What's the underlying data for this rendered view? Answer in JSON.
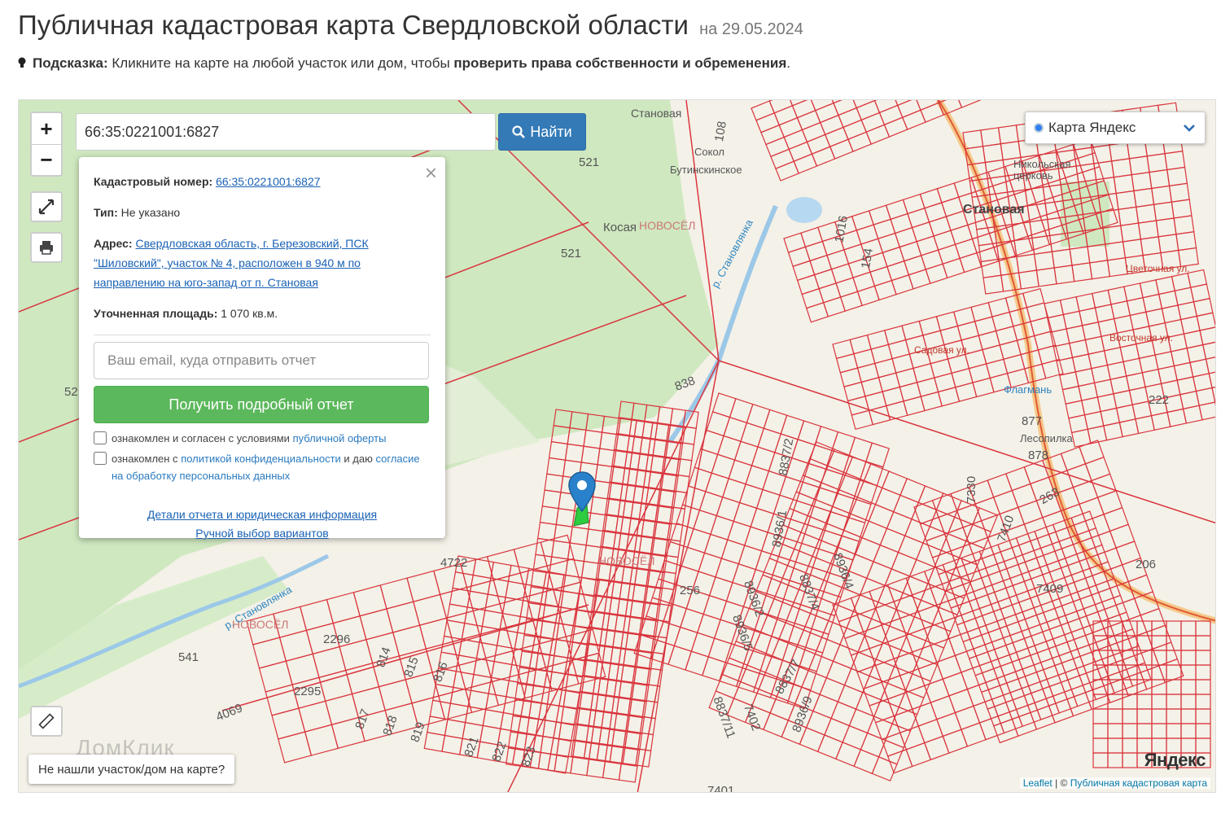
{
  "header": {
    "title": "Публичная кадастровая карта Свердловской области",
    "date": "на 29.05.2024"
  },
  "hint": {
    "label": "Подсказка:",
    "text": "Кликните на карте на любой участок или дом, чтобы",
    "bold_text": "проверить права собственности и обременения",
    "end": "."
  },
  "search": {
    "value": "66:35:0221001:6827",
    "button_label": "Найти"
  },
  "zoom": {
    "in": "+",
    "out": "−"
  },
  "layer": {
    "selected": "Карта Яндекс"
  },
  "popup": {
    "cadastral_label": "Кадастровый номер:",
    "cadastral_value": "66:35:0221001:6827",
    "type_label": "Тип:",
    "type_value": "Не указано",
    "address_label": "Адрес:",
    "address_value": "Свердловская область, г. Березовский, ПСК \"Шиловский\", участок № 4, расположен в 940 м по направлению на юго-запад от п. Становая",
    "area_label": "Уточненная площадь:",
    "area_value": "1 070 кв.м.",
    "email_placeholder": "Ваш email, куда отправить отчет",
    "report_button": "Получить подробный отчет",
    "check1_text": "ознакомлен и согласен с условиями",
    "check1_link": "публичной оферты",
    "check2_text1": "ознакомлен с",
    "check2_link1": "политикой конфиденциальности",
    "check2_text2": "и даю",
    "check2_link2": "согласие на обработку персональных данных",
    "details_link": "Детали отчета и юридическая информация",
    "manual_link": "Ручной выбор вариантов"
  },
  "not_found": "Не нашли участок/дом на карте?",
  "attribution": {
    "leaflet": "Leaflet",
    "sep": "| ©",
    "source": "Публичная кадастровая карта"
  },
  "yandex_logo": "Яндекс",
  "watermark": "ДомКлик",
  "map_labels": {
    "stanovaya_top": "Становая",
    "stanovaya": "Становая",
    "kosaya": "Косая",
    "novosel": "НОВОСЁЛ",
    "river1": "р. Становлянка",
    "river2": "р. Становлянка",
    "church": "Никольская церковь",
    "flagman": "Флагмань",
    "lesopilka": "Лесопилка",
    "cemetery": "Бутинскинское",
    "n521a": "521",
    "n521b": "521",
    "n838": "838",
    "n4722": "4722",
    "n256": "256",
    "n2296": "2296",
    "n2295": "2295",
    "n541": "541",
    "n4069": "4069",
    "n814": "814",
    "n815": "815",
    "n816": "816",
    "n817": "817",
    "n818": "818",
    "n819": "819",
    "n821": "821",
    "n822": "822",
    "n823": "823",
    "n8837_2": "8837/2",
    "n8936_1": "8936/1",
    "n8936_4": "8936/4",
    "n8837_4": "8837/4",
    "n8936_2": "8936/2",
    "n8936_5": "8936/5",
    "n8837_7": "8837/7",
    "n8837_11": "8837/11",
    "n7402": "7402",
    "n8936_9": "8936/9",
    "n7330": "7330",
    "n7410": "7410",
    "n7409": "7409",
    "n7401": "7401",
    "n206": "206",
    "n263": "263",
    "n877": "877",
    "n878": "878",
    "n222": "222",
    "n1016": "1016",
    "n154": "154",
    "n108": "108",
    "n52": "52",
    "street_sadovaya": "Садовая ул.",
    "street_vostochnaya": "Восточная ул.",
    "street_tsvetochnaya": "Цветочная ул.",
    "sadovy": "Сокол"
  },
  "colors": {
    "parcel": "#d9363e",
    "forest": "#cfe8c0",
    "road": "#f5c98a",
    "button_blue": "#337ab7",
    "button_green": "#5cb85c",
    "marker": "#2a81cb"
  }
}
